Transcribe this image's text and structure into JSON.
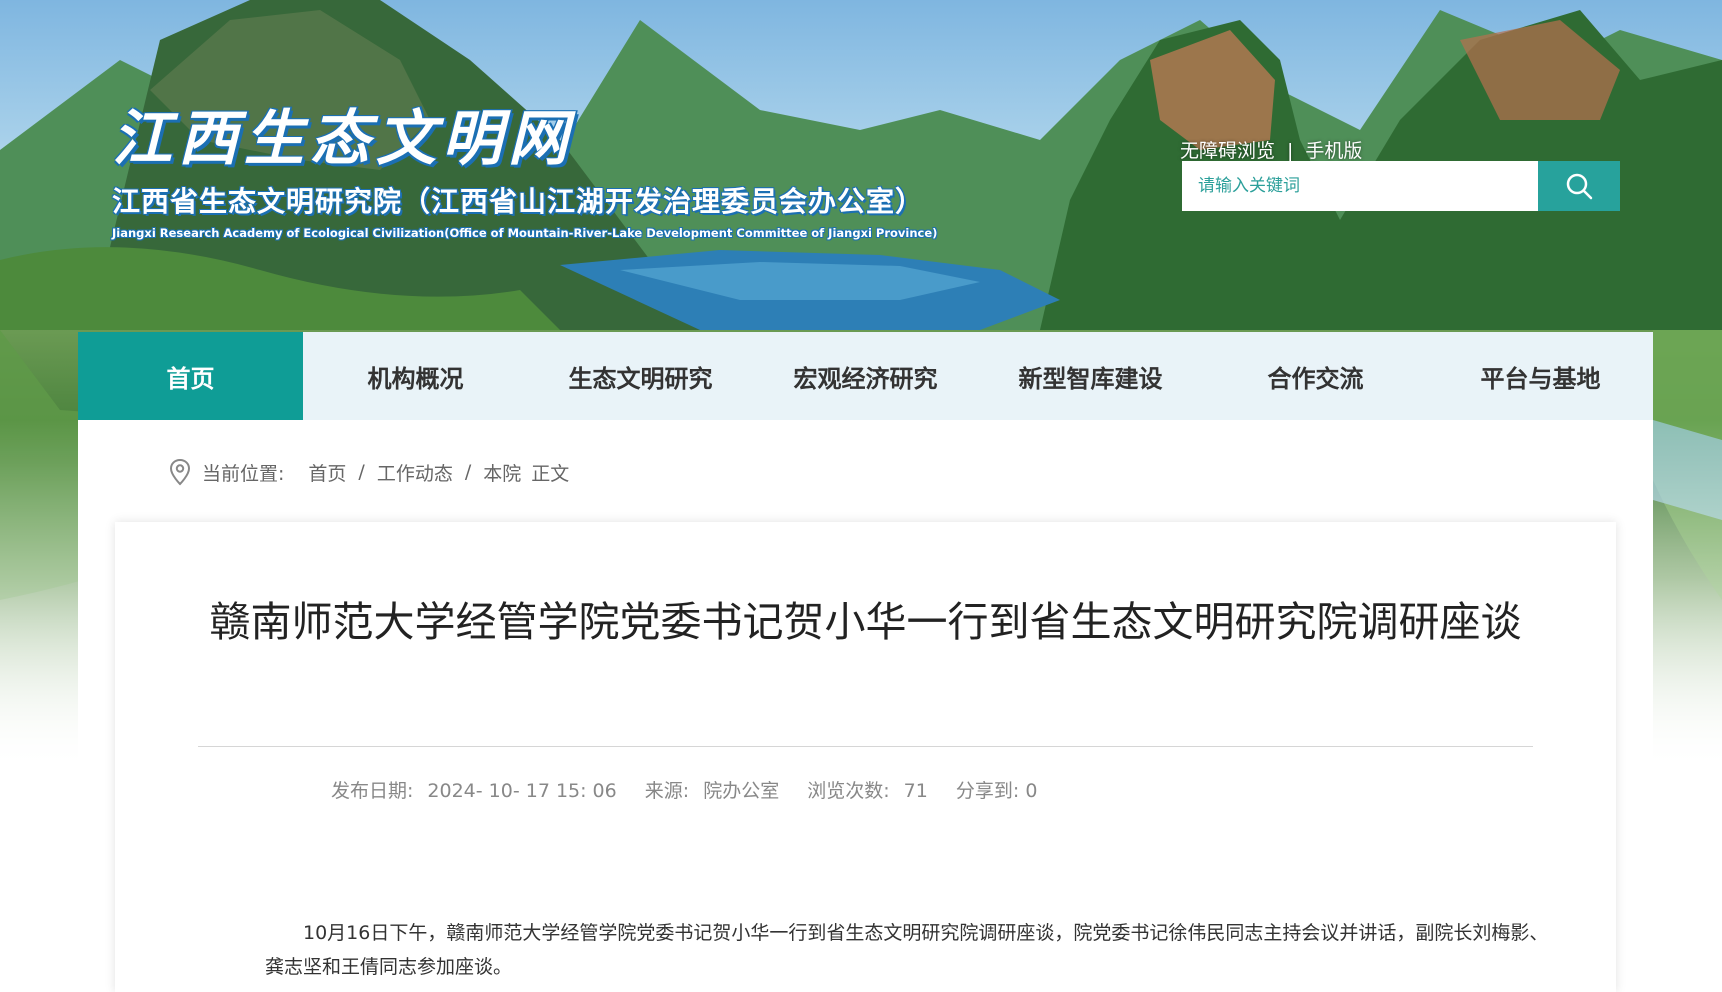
{
  "header": {
    "logo_main": "江西生态文明网",
    "logo_sub": "江西省生态文明研究院（江西省山江湖开发治理委员会办公室）",
    "logo_en": "Jiangxi Research Academy of Ecological Civilization(Office of Mountain-River-Lake Development Committee of Jiangxi Province)",
    "accessibility_link": "无障碍浏览",
    "link_separator": "|",
    "mobile_link": "手机版",
    "search_placeholder": "请输入关键词",
    "search_icon": "search-icon"
  },
  "nav": {
    "items": [
      {
        "label": "首页",
        "active": true
      },
      {
        "label": "机构概况"
      },
      {
        "label": "生态文明研究"
      },
      {
        "label": "宏观经济研究"
      },
      {
        "label": "新型智库建设"
      },
      {
        "label": "合作交流"
      },
      {
        "label": "平台与基地"
      }
    ]
  },
  "breadcrumb": {
    "icon": "location-pin-icon",
    "prefix": "当前位置:",
    "items": [
      "首页",
      "工作动态",
      "本院"
    ],
    "current": "正文"
  },
  "article": {
    "title": "赣南师范大学经管学院党委书记贺小华一行到省生态文明研究院调研座谈",
    "publish_date_label": "发布日期:",
    "publish_date": "2024- 10- 17 15: 06",
    "source_label": "来源:",
    "source": "院办公室",
    "views_label": "浏览次数:",
    "views": "71",
    "share_label": "分享到:",
    "share_count": "0",
    "paragraph": "10月16日下午，赣南师范大学经管学院党委书记贺小华一行到省生态文明研究院调研座谈，院党委书记徐伟民同志主持会议并讲话，副院长刘梅影、龚志坚和王倩同志参加座谈。"
  },
  "colors": {
    "accent": "#0f9d96",
    "search_button": "#27a29c",
    "nav_background": "#e9f3f8",
    "logo_outline": "#1b6fb3"
  }
}
